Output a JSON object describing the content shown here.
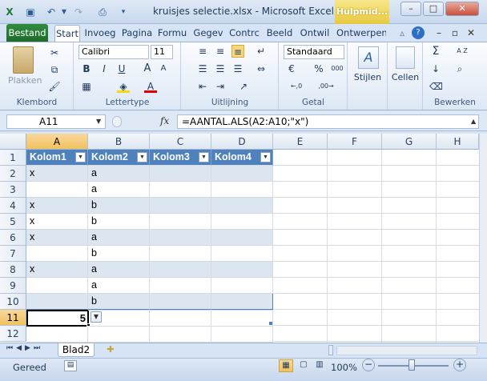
{
  "window": {
    "title": "kruisjes selectie.xlsx - Microsoft Excel",
    "contextual_tab": "Hulpmid...",
    "minimize": "–",
    "restore": "□",
    "close": "✕"
  },
  "quick_access": {
    "save_icon": "save-icon",
    "undo_icon": "undo-icon",
    "redo_icon": "redo-icon",
    "print_icon": "print-preview-icon"
  },
  "tabs": {
    "file": "Bestand",
    "items": [
      "Start",
      "Invoeg",
      "Pagina",
      "Formu",
      "Gegev",
      "Contrc",
      "Beeld",
      "Ontwil",
      "Ontwerpen"
    ],
    "active": "Start"
  },
  "ribbon": {
    "clipboard": {
      "paste": "Plakken",
      "label": "Klembord"
    },
    "font": {
      "name": "Calibri",
      "size": "11",
      "label": "Lettertype",
      "bold": "B",
      "italic": "I",
      "underline": "U",
      "grow": "A",
      "shrink": "A"
    },
    "alignment": {
      "label": "Uitlijning"
    },
    "number": {
      "format": "Standaard",
      "label": "Getal",
      "percent": "%",
      "thousands": "000",
      "increase_decimal": "←,0",
      "decrease_decimal": ",00→"
    },
    "styles": {
      "label": "Stijlen"
    },
    "cells": {
      "label": "Cellen"
    },
    "editing": {
      "label": "Bewerken",
      "sum": "Σ",
      "sort": "A Z"
    }
  },
  "formula_bar": {
    "name_box": "A11",
    "fx": "fx",
    "formula": "=AANTAL.ALS(A2:A10;\"x\")"
  },
  "grid": {
    "columns": [
      "A",
      "B",
      "C",
      "D",
      "E",
      "F",
      "G",
      "H"
    ],
    "rows": [
      "1",
      "2",
      "3",
      "4",
      "5",
      "6",
      "7",
      "8",
      "9",
      "10",
      "11",
      "12"
    ],
    "selected_cell": "A11",
    "table_headers": [
      "Kolom1",
      "Kolom2",
      "Kolom3",
      "Kolom4"
    ],
    "table_rows": [
      [
        "x",
        "a",
        "",
        ""
      ],
      [
        "",
        "a",
        "",
        ""
      ],
      [
        "x",
        "b",
        "",
        ""
      ],
      [
        "x",
        "b",
        "",
        ""
      ],
      [
        "x",
        "a",
        "",
        ""
      ],
      [
        "",
        "b",
        "",
        ""
      ],
      [
        "x",
        "a",
        "",
        ""
      ],
      [
        "",
        "a",
        "",
        ""
      ],
      [
        "",
        "b",
        "",
        ""
      ]
    ],
    "result_value": "5"
  },
  "sheets": {
    "tabs": [
      "Blad2"
    ],
    "active": "Blad2"
  },
  "status": {
    "ready": "Gereed",
    "zoom": "100%",
    "zoom_out": "−",
    "zoom_in": "+"
  }
}
